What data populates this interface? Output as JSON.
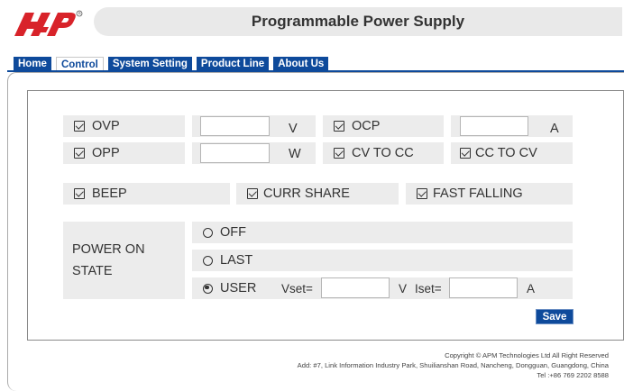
{
  "header": {
    "logo_text": "APM",
    "title": "Programmable Power Supply"
  },
  "tabs": [
    {
      "label": "Home",
      "active": false
    },
    {
      "label": "Control",
      "active": true
    },
    {
      "label": "System Setting",
      "active": false
    },
    {
      "label": "Product Line",
      "active": false
    },
    {
      "label": "About Us",
      "active": false
    }
  ],
  "protection": {
    "ovp": {
      "label": "OVP",
      "checked": true,
      "value": "",
      "unit": "V"
    },
    "ocp": {
      "label": "OCP",
      "checked": true,
      "value": "",
      "unit": "A"
    },
    "opp": {
      "label": "OPP",
      "checked": true,
      "value": "",
      "unit": "W"
    },
    "cv_to_cc": {
      "label": "CV TO CC",
      "checked": true
    },
    "cc_to_cv": {
      "label": "CC TO CV",
      "checked": true
    }
  },
  "options": {
    "beep": {
      "label": "BEEP",
      "checked": true
    },
    "curr_share": {
      "label": "CURR SHARE",
      "checked": true
    },
    "fast_falling": {
      "label": "FAST FALLING",
      "checked": true
    }
  },
  "power_on_state": {
    "label_line1": "POWER ON",
    "label_line2": "STATE",
    "options": [
      {
        "label": "OFF",
        "selected": false
      },
      {
        "label": "LAST",
        "selected": false
      },
      {
        "label": "USER",
        "selected": true
      }
    ],
    "vset_label": "Vset=",
    "vset_value": "",
    "vset_unit": "V",
    "iset_label": "Iset=",
    "iset_value": "",
    "iset_unit": "A"
  },
  "save_label": "Save",
  "footer": {
    "copyright": "Copyright © APM Technologies Ltd All Right Reserved",
    "address": "Add: #7, Link Information Industry Park, Shuilianshan Road, Nancheng, Dongguan, Guangdong, China",
    "tel": "Tel :+86 769 2202 8588"
  },
  "colors": {
    "accent": "#0e4a9b",
    "logo_red": "#d8232a",
    "cell_bg": "#ececec"
  }
}
